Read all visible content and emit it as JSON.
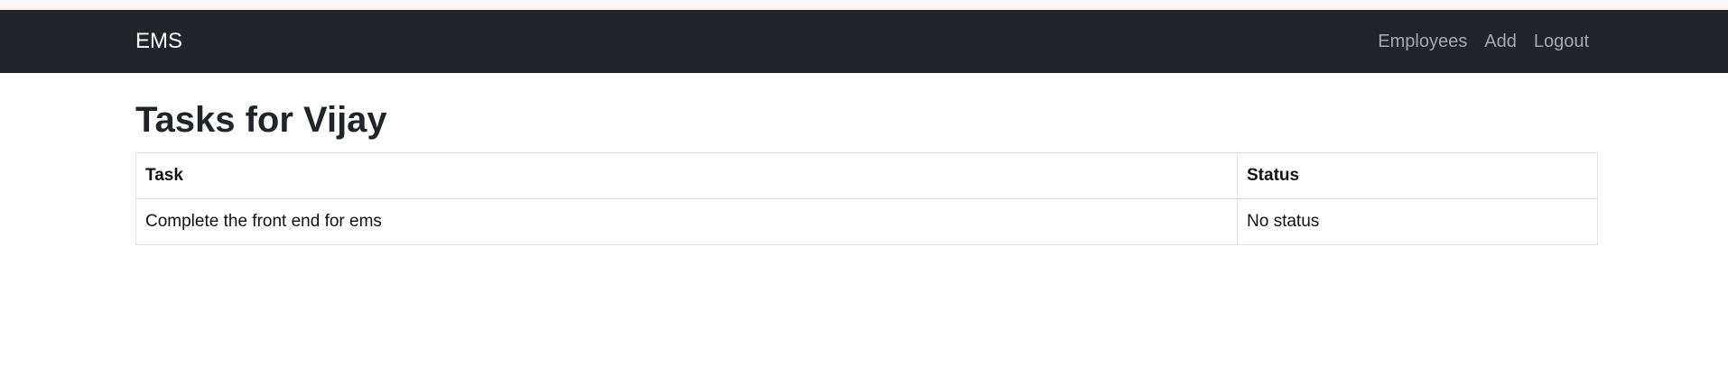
{
  "navbar": {
    "brand": "EMS",
    "links": [
      {
        "label": "Employees"
      },
      {
        "label": "Add"
      },
      {
        "label": "Logout"
      }
    ]
  },
  "main": {
    "title": "Tasks for Vijay",
    "table": {
      "headers": [
        "Task",
        "Status"
      ],
      "rows": [
        [
          "Complete the front end for ems",
          "No status"
        ]
      ]
    }
  }
}
